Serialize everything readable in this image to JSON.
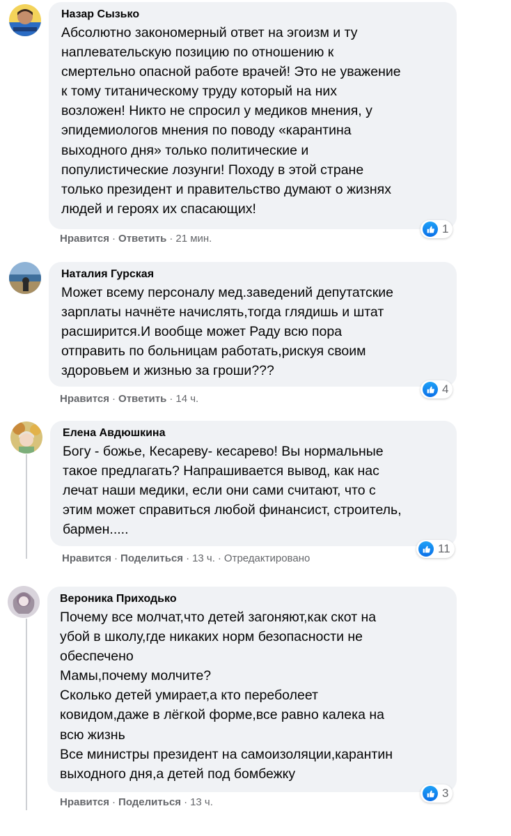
{
  "comments": [
    {
      "author": "Назар Сызько",
      "text_lines": [
        "Абсолютно закономерный ответ на эгоизм и ту",
        "наплевательскую позицию по отношению к",
        "смертельно опасной работе врачей! Это не уважение",
        "к тому титаническому труду который на них",
        "возложен! Никто не спросил у медиков мнения, у",
        "эпидемиологов мнения по поводу «карантина",
        "выходного дня» только политические и",
        "популистические лозунги! Походу в этой стране",
        "только президент и правительство думают о жизнях",
        "людей и героях их спасающих!"
      ],
      "reaction_count": "1",
      "like_label": "Нравится",
      "sep1": "·",
      "second_action": "Ответить",
      "sep2": "·",
      "time": "21 мин.",
      "edited": ""
    },
    {
      "author": "Наталия Гурская",
      "text_lines": [
        "Может всему персоналу мед.заведений депутатские",
        "зарплаты начнёте начислять,тогда глядишь и штат",
        "расширится.И вообще может Раду всю пора",
        "отправить по больницам работать,рискуя своим",
        "здоровьем и жизнью за гроши???"
      ],
      "reaction_count": "4",
      "like_label": "Нравится",
      "sep1": "·",
      "second_action": "Ответить",
      "sep2": "·",
      "time": "14 ч.",
      "edited": ""
    },
    {
      "author": "Елена Авдюшкина",
      "text_lines": [
        "Богу - божье, Кесареву- кесарево! Вы нормальные",
        "такое предлагать? Напрашивается вывод, как нас",
        "лечат наши медики, если они сами считают, что с",
        "этим может справиться любой финансист, строитель,",
        "бармен....."
      ],
      "reaction_count": "11",
      "like_label": "Нравится",
      "sep1": "·",
      "second_action": "Поделиться",
      "sep2": "·",
      "time": "13 ч.",
      "sep3": "·",
      "edited": "Отредактировано"
    },
    {
      "author": "Вероника Приходько",
      "text_lines": [
        "Почему все молчат,что детей загоняют,как скот на",
        "убой в школу,где никаких норм безопасности не",
        "обеспечено",
        "Мамы,почему молчите?",
        "Сколько детей умирает,а кто переболеет",
        "ковидом,даже в лёгкой форме,все равно калека на",
        "всю жизнь",
        "Все министры президент на самоизоляции,карантин",
        "выходного дня,а детей под бомбежку"
      ],
      "reaction_count": "3",
      "like_label": "Нравится",
      "sep1": "·",
      "second_action": "Поделиться",
      "sep2": "·",
      "time": "13 ч.",
      "edited": ""
    }
  ],
  "icons": {
    "like": "like-thumb-icon",
    "avatar": "avatar"
  },
  "colors": {
    "bubble": "#f0f2f5",
    "meta_text": "#65676b",
    "like_blue": "#1877f2"
  }
}
